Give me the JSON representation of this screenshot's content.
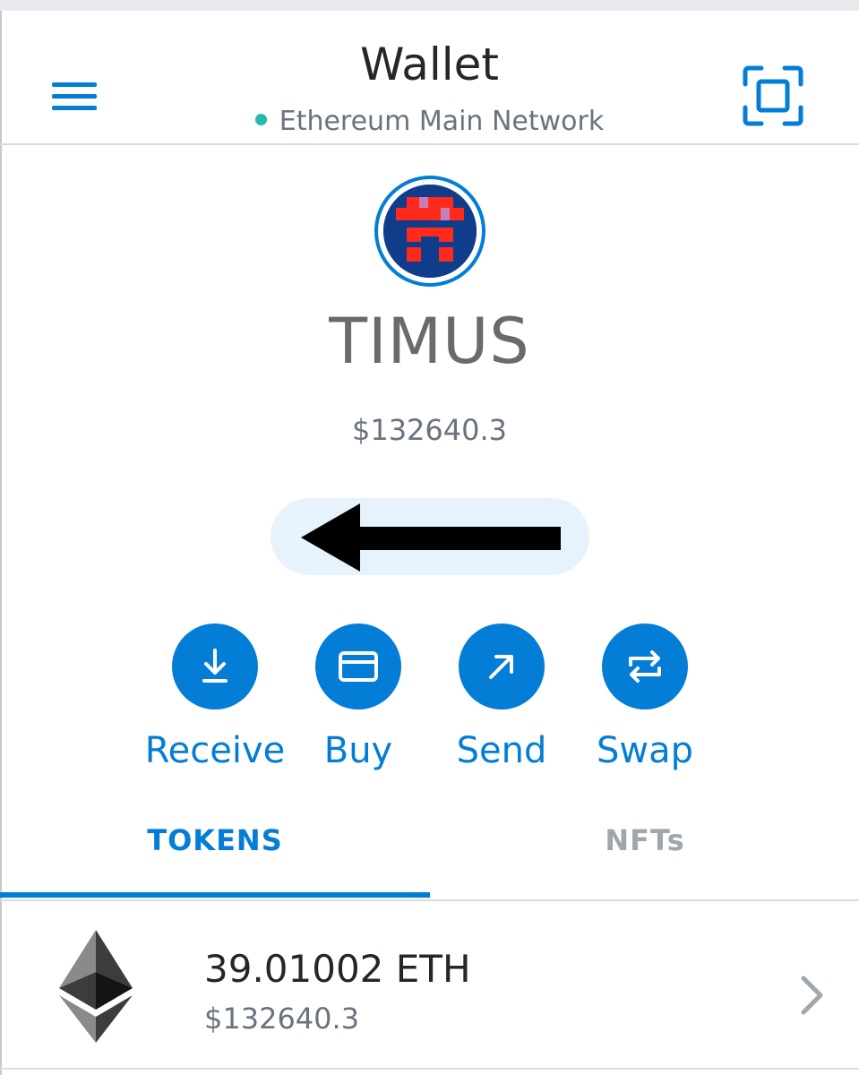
{
  "header": {
    "title": "Wallet",
    "network": "Ethereum Main Network",
    "network_dot_color": "#29b6af"
  },
  "account": {
    "name": "TIMUS",
    "balance": "$132640.3"
  },
  "actions": [
    {
      "label": "Receive",
      "icon": "download-icon"
    },
    {
      "label": "Buy",
      "icon": "card-icon"
    },
    {
      "label": "Send",
      "icon": "arrow-up-right-icon"
    },
    {
      "label": "Swap",
      "icon": "swap-icon"
    }
  ],
  "tabs": [
    {
      "label": "TOKENS",
      "active": true
    },
    {
      "label": "NFTs",
      "active": false
    }
  ],
  "tokens": [
    {
      "amount": "39.01002 ETH",
      "fiat": "$132640.3",
      "icon": "ethereum-icon"
    }
  ],
  "colors": {
    "accent": "#037dd6",
    "muted": "#6a737d",
    "pill": "#e6f2fc"
  }
}
